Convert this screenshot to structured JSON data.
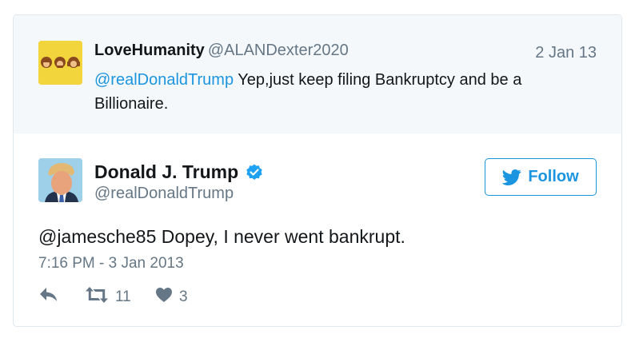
{
  "reply_tweet": {
    "display_name": "LoveHumanity",
    "handle": "@ALANDexter2020",
    "date": "2 Jan 13",
    "mention": "@realDonaldTrump",
    "text": " Yep,just keep filing Bankruptcy and be a Billionaire."
  },
  "main_tweet": {
    "display_name": "Donald J. Trump",
    "handle": "@realDonaldTrump",
    "follow_label": "Follow",
    "text": "@jamesche85 Dopey, I never went bankrupt.",
    "timestamp": "7:16 PM - 3 Jan 2013",
    "retweet_count": "11",
    "like_count": "3"
  },
  "colors": {
    "link": "#1b95e0",
    "muted": "#657786",
    "reply_background": "#f5f8fa",
    "border": "#e1e8ed"
  },
  "icons": {
    "verified": "verified-badge-icon",
    "follow": "twitter-bird-icon",
    "reply": "reply-arrow-icon",
    "retweet": "retweet-icon",
    "like": "heart-icon"
  }
}
